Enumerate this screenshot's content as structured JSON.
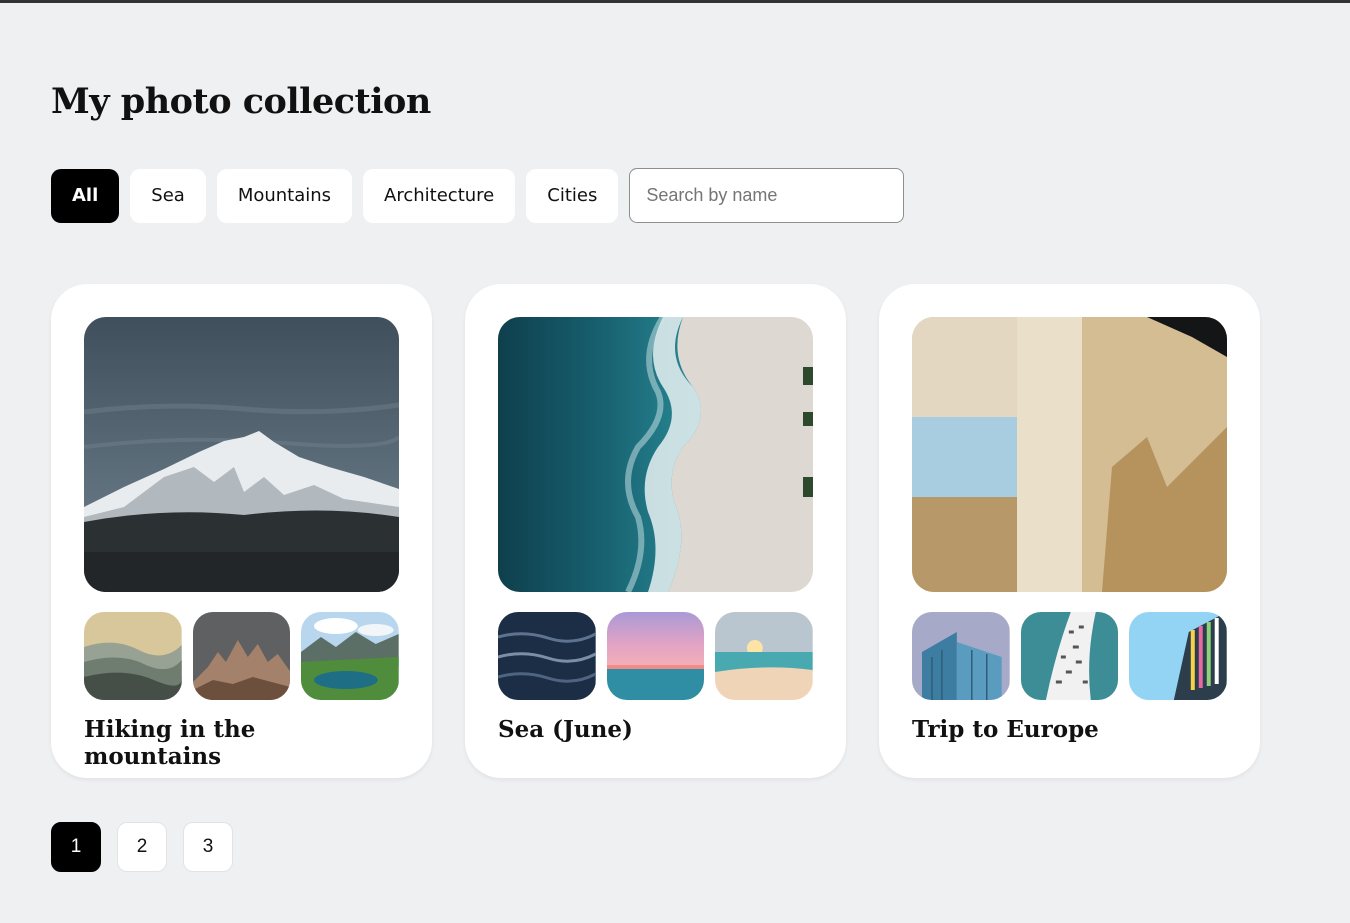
{
  "page": {
    "title": "My photo collection"
  },
  "filters": {
    "items": [
      {
        "label": "All",
        "active": true
      },
      {
        "label": "Sea",
        "active": false
      },
      {
        "label": "Mountains",
        "active": false
      },
      {
        "label": "Architecture",
        "active": false
      },
      {
        "label": "Cities",
        "active": false
      }
    ]
  },
  "search": {
    "placeholder": "Search by name",
    "value": ""
  },
  "collections": [
    {
      "title": "Hiking in the mountains"
    },
    {
      "title": "Sea (June)"
    },
    {
      "title": "Trip to Europe"
    }
  ],
  "pagination": {
    "pages": [
      "1",
      "2",
      "3"
    ],
    "current": "1"
  },
  "colors": {
    "accent": "#000000",
    "background": "#eff0f2",
    "card": "#ffffff"
  }
}
